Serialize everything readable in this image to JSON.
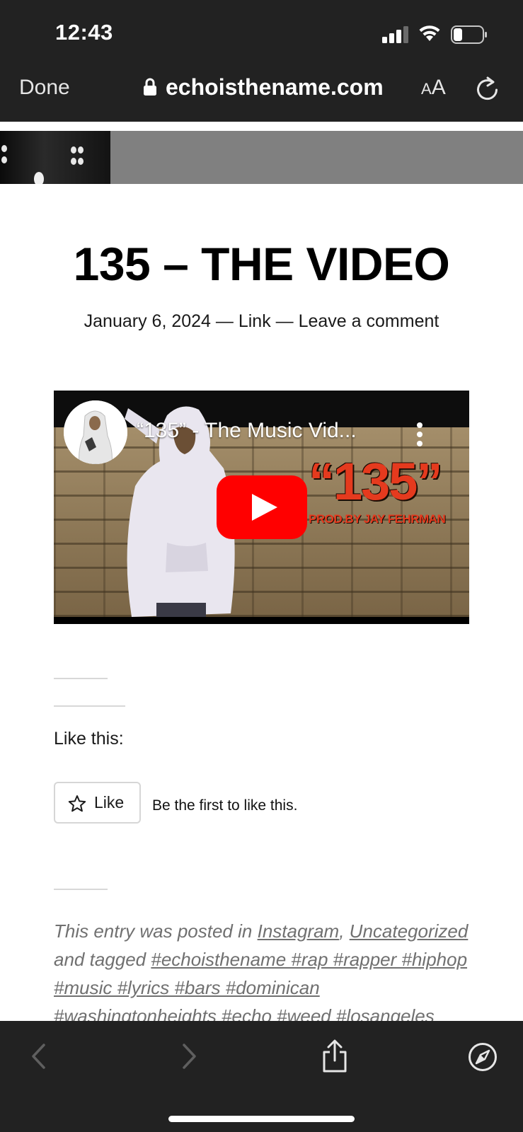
{
  "status_bar": {
    "time": "12:43"
  },
  "browser": {
    "done_label": "Done",
    "url": "echoisthename.com",
    "text_size_small": "A",
    "text_size_big": "A"
  },
  "post": {
    "title": "135 – THE VIDEO",
    "meta": "January 6, 2024 — Link — Leave a comment"
  },
  "video": {
    "title": "“135” - The Music Vid...",
    "overlay_number": "“135”",
    "overlay_credit": "PROD.BY JAY FEHRMAN"
  },
  "like": {
    "heading": "Like this:",
    "button_label": "Like",
    "count_text": "Be the first to like this."
  },
  "entry_footer": {
    "prefix": "This entry was posted in",
    "category_1": "Instagram",
    "comma": ",",
    "category_2": "Uncategorized",
    "tagged_label": "and tagged",
    "tags": "#echoisthename #rap #rapper #hiphop #music #lyrics #bars #dominican #washingtonheights #echo #weed #losangeles"
  },
  "colors": {
    "chrome_background": "#222222",
    "youtube_red": "#ff0000",
    "overlay_red": "#e53a1e",
    "link_gray": "#707070"
  },
  "icons": [
    "signal-icon",
    "wifi-icon",
    "battery-icon",
    "lock-icon",
    "reload-icon",
    "play-icon",
    "more-vertical-icon",
    "star-icon",
    "back-arrow-icon",
    "forward-arrow-icon",
    "share-icon",
    "compass-icon"
  ]
}
